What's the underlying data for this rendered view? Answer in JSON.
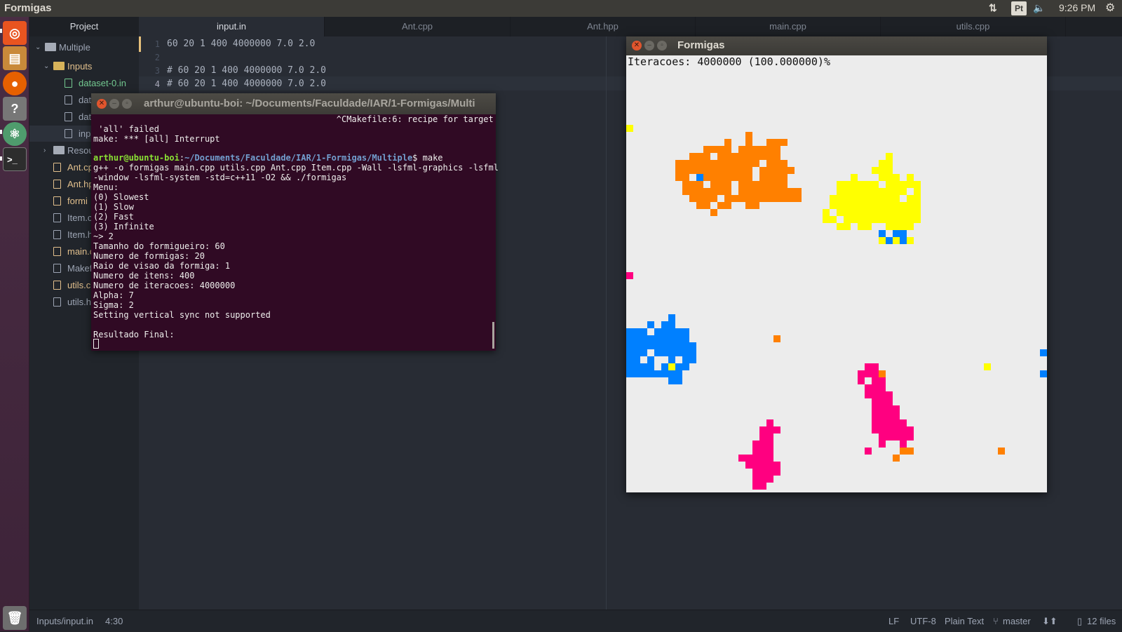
{
  "top_panel": {
    "app_title": "Formigas",
    "network_icon": "network-arrows-icon",
    "keyboard_layout": "Pt",
    "volume_icon": "muted-speaker-icon",
    "time": "9:26 PM",
    "settings_icon": "gear-icon"
  },
  "launcher": {
    "items": [
      {
        "name": "ubuntu-dash-icon",
        "color": "#e95420"
      },
      {
        "name": "files-icon",
        "color": "#e0a446"
      },
      {
        "name": "firefox-icon",
        "color": "#e66000"
      },
      {
        "name": "help-icon",
        "color": "#8a8a8a"
      },
      {
        "name": "atom-icon",
        "color": "#66595c"
      },
      {
        "name": "terminal-icon",
        "color": "#2d2d2d"
      },
      {
        "name": "trash-icon",
        "color": "#888888"
      }
    ]
  },
  "project": {
    "header": "Project",
    "root": "Multiple",
    "inputs_folder": "Inputs",
    "files": [
      {
        "label": "dataset-0.in",
        "status": "added"
      },
      {
        "label": "dat",
        "status": "normal"
      },
      {
        "label": "dat",
        "status": "normal"
      },
      {
        "label": "inp",
        "status": "normal"
      }
    ],
    "resources_folder": "Resou",
    "root_files": [
      {
        "label": "Ant.cp",
        "status": "modified"
      },
      {
        "label": "Ant.hp",
        "status": "modified"
      },
      {
        "label": "formi",
        "status": "modified"
      },
      {
        "label": "Item.c",
        "status": "normal"
      },
      {
        "label": "Item.h",
        "status": "normal"
      },
      {
        "label": "main.c",
        "status": "modified"
      },
      {
        "label": "Makef",
        "status": "normal"
      },
      {
        "label": "utils.c",
        "status": "modified"
      },
      {
        "label": "utils.h",
        "status": "normal"
      }
    ]
  },
  "tabs": [
    "input.in",
    "Ant.cpp",
    "Ant.hpp",
    "main.cpp",
    "utils.cpp"
  ],
  "editor": {
    "lines": [
      {
        "num": "1",
        "text": "60 20 1 400 4000000 7.0 2.0"
      },
      {
        "num": "2",
        "text": ""
      },
      {
        "num": "3",
        "text": "# 60 20 1 400 4000000 7.0 2.0"
      },
      {
        "num": "4",
        "text": "# 60 20 1 400 4000000 7.0 2.0"
      }
    ]
  },
  "status_bar": {
    "path": "Inputs/input.in",
    "cursor": "4:30",
    "line_ending": "LF",
    "encoding": "UTF-8",
    "grammar": "Plain Text",
    "branch": "master",
    "files": "12 files"
  },
  "terminal": {
    "title": "arthur@ubuntu-boi: ~/Documents/Faculdade/IAR/1-Formigas/Multi",
    "line_0": "                                                ^CMakefile:6: recipe for target",
    "line_1": " 'all' failed",
    "line_2": "make: *** [all] Interrupt",
    "prompt_user": "arthur@ubuntu-boi",
    "prompt_path": "~/Documents/Faculdade/IAR/1-Formigas/Multiple",
    "prompt_cmd": "$ make",
    "line_5": "g++ -o formigas main.cpp utils.cpp Ant.cpp Item.cpp -Wall -lsfml-graphics -lsfml",
    "line_6": "-window -lsfml-system -std=c++11 -O2 && ./formigas",
    "line_7": "Menu:",
    "line_8": "(0) Slowest",
    "line_9": "(1) Slow",
    "line_10": "(2) Fast",
    "line_11": "(3) Infinite",
    "line_12": "~> 2",
    "line_13": "Tamanho do formigueiro: 60",
    "line_14": "Numero de formigas: 20",
    "line_15": "Raio de visao da formiga: 1",
    "line_16": "Numero de itens: 400",
    "line_17": "Numero de iteracoes: 4000000",
    "line_18": "Alpha: 7",
    "line_19": "Sigma: 2",
    "line_20": "Setting vertical sync not supported",
    "line_21": "",
    "line_22": "Resultado Final:"
  },
  "sfml_window": {
    "title": "Formigas",
    "iterations_text": "Iteracoes: 4000000 (100.000000)%",
    "grid_size": 60,
    "colors": {
      "orange": "#ff8000",
      "yellow": "#ffff00",
      "blue": "#0080ff",
      "pink": "#ff0080",
      "bg": "#ececec"
    },
    "clusters": {
      "orange": [
        "...........#.......",
        "........#..#..###..",
        ".....####.######...",
        "...###.#########...",
        ".############.###..",
        ".###########.#####.",
        ".##.########.####..",
        "..###.###.#######..",
        "..#######.#########",
        "...####.###########",
        "....##.##..##......",
        "......#............"
      ],
      "yellow": [
        ".........#....",
        "........##....",
        ".......###....",
        "....#...###.#.",
        "..######.#####",
        "..##########.#",
        ".##########.##",
        ".#############",
        "#.############",
        "##.###########",
        "..##.##..####.",
        "........#..#..",
        "........#####."
      ],
      "blue": [
        "......#...",
        "...#.##...",
        "###.#####.",
        "#########.",
        "##########",
        "###.######",
        "##.#..#.##",
        "####.####.",
        "########..",
        "......##.."
      ],
      "pink": [
        ".##.....",
        "###.....",
        "#.##....",
        ".###....",
        ".####...",
        "..###...",
        "..####..",
        "..####..",
        "..#####.",
        "..######",
        "...#####",
        "...#..#."
      ],
      "pink2": [
        "....#.",
        "...###",
        "...##.",
        "..###.",
        "..###.",
        "#####.",
        ".#####",
        "..####",
        "..###.",
        "..##.."
      ]
    }
  }
}
